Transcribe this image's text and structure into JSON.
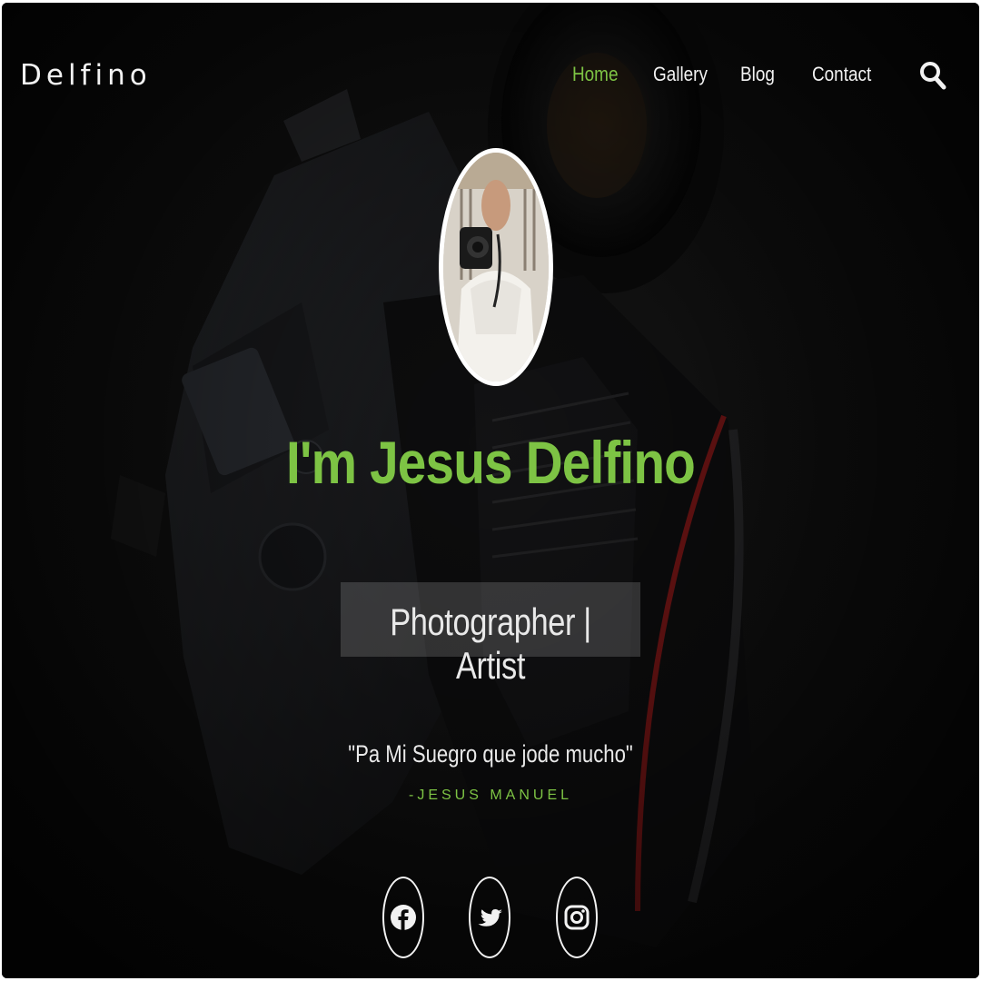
{
  "brand": "Delfino",
  "nav": {
    "items": [
      {
        "label": "Home",
        "active": true
      },
      {
        "label": "Gallery",
        "active": false
      },
      {
        "label": "Blog",
        "active": false
      },
      {
        "label": "Contact",
        "active": false
      }
    ],
    "search_icon": "search-icon"
  },
  "hero": {
    "title": "I'm Jesus Delfino",
    "role": "Photographer | Artist",
    "quote": "\"Pa Mi Suegro que jode mucho\"",
    "quote_author": "-JESUS MANUEL",
    "avatar": "profile-photo"
  },
  "social": [
    {
      "name": "facebook",
      "icon": "facebook-icon"
    },
    {
      "name": "twitter",
      "icon": "twitter-icon"
    },
    {
      "name": "instagram",
      "icon": "instagram-icon"
    }
  ],
  "colors": {
    "accent": "#7dc344",
    "text": "#f2f2f2",
    "background": "#0b0b0b"
  }
}
